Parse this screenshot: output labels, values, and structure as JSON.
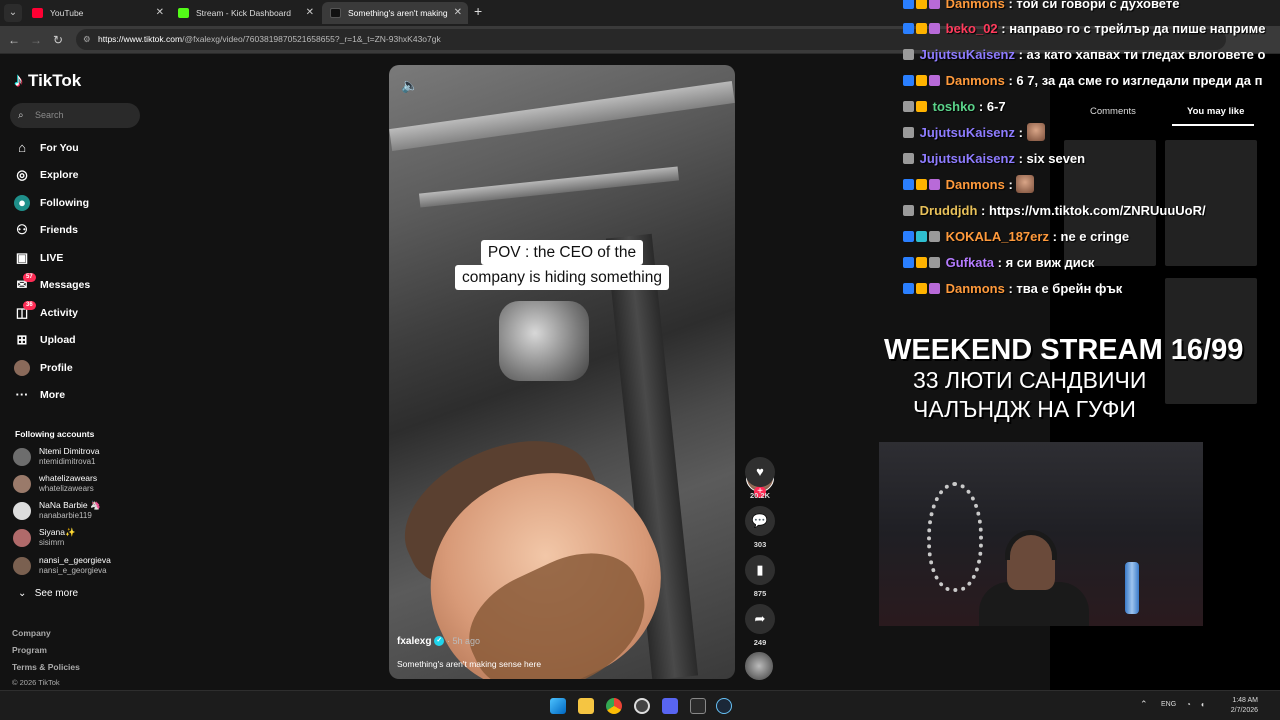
{
  "browser": {
    "tabs": [
      {
        "label": "YouTube",
        "favicon_color": "#ff0033"
      },
      {
        "label": "Stream - Kick Dashboard",
        "favicon_color": "#53fc18"
      },
      {
        "label": "Something's aren't making",
        "favicon_color": "#111111"
      }
    ],
    "url_host": "https://www.tiktok.com",
    "url_path": "/@fxalexg/video/7603819870521658655?_r=1&_t=ZN-93hxK43o7gk"
  },
  "tiktok": {
    "logo": "TikTok",
    "search_placeholder": "Search",
    "nav": [
      {
        "label": "For You",
        "icon": "home-icon"
      },
      {
        "label": "Explore",
        "icon": "compass-icon"
      },
      {
        "label": "Following",
        "icon": "following-icon"
      },
      {
        "label": "Friends",
        "icon": "friends-icon"
      },
      {
        "label": "LIVE",
        "icon": "live-icon"
      },
      {
        "label": "Messages",
        "icon": "messages-icon",
        "badge": "57"
      },
      {
        "label": "Activity",
        "icon": "activity-icon",
        "badge": "36"
      },
      {
        "label": "Upload",
        "icon": "upload-icon"
      },
      {
        "label": "Profile",
        "icon": "profile-icon"
      },
      {
        "label": "More",
        "icon": "more-icon"
      }
    ],
    "following_header": "Following accounts",
    "accounts": [
      {
        "name": "Ntemi Dimitrova",
        "handle": "ntemidimitrova1"
      },
      {
        "name": "whatelizawears",
        "handle": "whatelizawears"
      },
      {
        "name": "NaNa Barbie 🦄",
        "handle": "nanabarbie119"
      },
      {
        "name": "Siyana✨",
        "handle": "sisimrn"
      },
      {
        "name": "nansi_e_georgieva",
        "handle": "nansi_e_georgieva"
      }
    ],
    "see_more": "See more",
    "footer": [
      "Company",
      "Program",
      "Terms & Policies"
    ],
    "copyright": "© 2026 TikTok",
    "video": {
      "caption_line1": "POV : the CEO of the",
      "caption_line2": "company is hiding something",
      "author": "fxalexg",
      "time": "· 5h ago",
      "description": "Something's aren't making sense here",
      "likes": "20.2K",
      "comments": "303",
      "saves": "875",
      "shares": "249"
    }
  },
  "stream": {
    "chat": [
      {
        "user": "Danmons",
        "color": "#ff9a3c",
        "msg": ": той си говори с духовете"
      },
      {
        "user": "beko_02",
        "color": "#ff3b5c",
        "msg": ": направо го с трейлър да пише наприме"
      },
      {
        "user": "JujutsuKaisenz",
        "color": "#8e7cff",
        "msg": ": аз като хапвах ти гледах влоговете о"
      },
      {
        "user": "Danmons",
        "color": "#ff9a3c",
        "msg": ": 6 7, за да сме го изгледали преди да п"
      },
      {
        "user": "toshko",
        "color": "#5bd38a",
        "msg": ": 6-7"
      },
      {
        "user": "JujutsuKaisenz",
        "color": "#8e7cff",
        "msg": ":",
        "emote": true
      },
      {
        "user": "JujutsuKaisenz",
        "color": "#8e7cff",
        "msg": ": six seven"
      },
      {
        "user": "Danmons",
        "color": "#ff9a3c",
        "msg": ":",
        "emote": true
      },
      {
        "user": "Druddjdh",
        "color": "#e8c15a",
        "msg": ": https://vm.tiktok.com/ZNRUuuUoR/"
      },
      {
        "user": "KOKALA_187erz",
        "color": "#ff9a3c",
        "msg": ": ne e cringe"
      },
      {
        "user": "Gufkata",
        "color": "#b57cff",
        "msg": ": я си виж диск"
      },
      {
        "user": "Danmons",
        "color": "#ff9a3c",
        "msg": ": тва е брейн фък"
      }
    ],
    "panel_tabs": [
      "Comments",
      "You may like"
    ],
    "title_line1": "WEEKEND STREAM 16/99",
    "title_line2": "33 ЛЮТИ САНДВИЧИ",
    "title_line3": "ЧАЛЪНДЖ НА ГУФИ"
  },
  "taskbar": {
    "lang": "ENG",
    "time": "1:48 AM",
    "date": "2/7/2026"
  }
}
